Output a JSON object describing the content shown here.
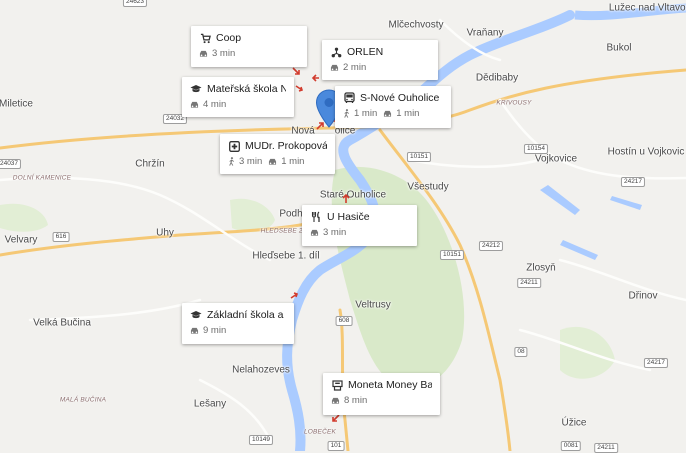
{
  "places": [
    {
      "name": "Mlčechvosty"
    },
    {
      "name": "Vraňany"
    },
    {
      "name": "Lužec nad Vltavou"
    },
    {
      "name": "Bukol"
    },
    {
      "name": "Dědibaby"
    },
    {
      "name": "KRIVOUSY"
    },
    {
      "name": "Miletice"
    },
    {
      "name": "Vojkovice"
    },
    {
      "name": "Hostín u Vojkovic"
    },
    {
      "name": "Chržín"
    },
    {
      "name": "DOLNÍ KAMENICE"
    },
    {
      "name": "Všestudy"
    },
    {
      "name": "Staré Ouholice"
    },
    {
      "name": "Podh"
    },
    {
      "name": "HLEDSEBE 2. DÍL"
    },
    {
      "name": "Uhy"
    },
    {
      "name": "Velvary"
    },
    {
      "name": "Hleďsebe 1. díl"
    },
    {
      "name": "Zlosyň"
    },
    {
      "name": "Dřinov"
    },
    {
      "name": "Veltrusy"
    },
    {
      "name": "Velká Bučina"
    },
    {
      "name": "Nelahozeves"
    },
    {
      "name": "MALÁ BUČINA"
    },
    {
      "name": "Lešany"
    },
    {
      "name": "LOBEČEK"
    },
    {
      "name": "Úžice"
    },
    {
      "name": "Nová"
    },
    {
      "name": "olice"
    }
  ],
  "road_shields": [
    "24623",
    "24032",
    "24037",
    "616",
    "10151",
    "10154",
    "24217",
    "24212",
    "10151",
    "24211",
    "608",
    "08",
    "24217",
    "10149",
    "101",
    "0081",
    "24211"
  ],
  "pois": [
    {
      "name": "Coop",
      "icon": "cart-icon",
      "modes": [
        {
          "icon": "car-icon",
          "time": "3 min"
        }
      ]
    },
    {
      "name": "ORLEN",
      "icon": "gas-station-icon",
      "modes": [
        {
          "icon": "car-icon",
          "time": "2 min"
        }
      ]
    },
    {
      "name": "Mateřská škola N...",
      "icon": "school-icon",
      "modes": [
        {
          "icon": "car-icon",
          "time": "4 min"
        }
      ]
    },
    {
      "name": "S-Nové Ouholice",
      "icon": "bus-icon",
      "modes": [
        {
          "icon": "walk-icon",
          "time": "1 min"
        },
        {
          "icon": "car-icon",
          "time": "1 min"
        }
      ]
    },
    {
      "name": "MUDr. Prokopová ...",
      "icon": "medical-icon",
      "modes": [
        {
          "icon": "walk-icon",
          "time": "3 min"
        },
        {
          "icon": "car-icon",
          "time": "1 min"
        }
      ]
    },
    {
      "name": "U Hasiče",
      "icon": "restaurant-icon",
      "modes": [
        {
          "icon": "car-icon",
          "time": "3 min"
        }
      ]
    },
    {
      "name": "Základní škola a ...",
      "icon": "school-icon",
      "modes": [
        {
          "icon": "car-icon",
          "time": "9 min"
        }
      ]
    },
    {
      "name": "Moneta Money Bank",
      "icon": "bank-icon",
      "modes": [
        {
          "icon": "car-icon",
          "time": "8 min"
        }
      ]
    }
  ],
  "pin": {
    "icon": "map-pin-icon",
    "color": "#4a89dc"
  },
  "colors": {
    "water": "#aacbff",
    "highway": "#f5c875",
    "road": "#ffffff",
    "green": "#d9e9c9",
    "arrow": "#d23c2e"
  }
}
